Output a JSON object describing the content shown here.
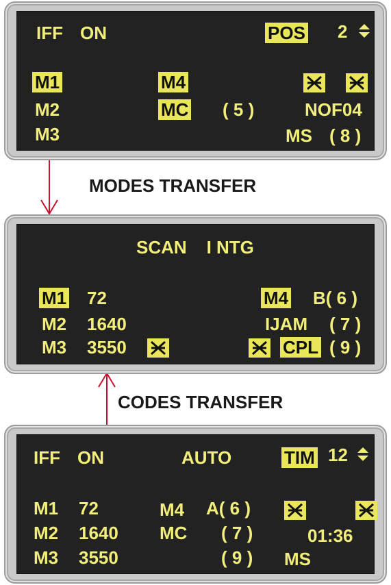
{
  "top": {
    "iff": "IFF",
    "on": "ON",
    "pos": "POS",
    "pos_num": "2",
    "m1": "M1",
    "m2": "M2",
    "m3": "M3",
    "m4": "M4",
    "mc": "MC",
    "mc_val": "( 5 )",
    "nof": "NOF04",
    "ms": "MS",
    "ms_val": "( 8 )"
  },
  "modes_transfer": "MODES TRANSFER",
  "middle": {
    "title": "SCAN    I NTG",
    "m1": "M1",
    "m1_val": "72",
    "m2": "M2",
    "m2_val": "1640",
    "m3": "M3",
    "m3_val": "3550",
    "m4": "M4",
    "m4_val": "B( 6 )",
    "ijam": "IJAM",
    "ijam_val": "( 7 )",
    "cpl": "CPL",
    "cpl_val": "( 9 )"
  },
  "codes_transfer": "CODES TRANSFER",
  "bottom": {
    "iff": "IFF",
    "on": "ON",
    "auto": "AUTO",
    "tim": "TIM",
    "tim_num": "12",
    "m1": "M1",
    "m1_val": "72",
    "m2": "M2",
    "m2_val": "1640",
    "m3": "M3",
    "m3_val": "3550",
    "m4": "M4",
    "m4_val": "A( 6 )",
    "mc": "MC",
    "mc_val": "( 7 )",
    "p9": "( 9 )",
    "time": "01:36",
    "ms": "MS"
  },
  "colors": {
    "screen_bg": "#222222",
    "text": "#f2ee7c",
    "highlight": "#e9e65a",
    "arrow": "#c8102e"
  },
  "icons": [
    "x-cross-icon",
    "updown-arrows-icon",
    "red-arrow-down",
    "red-arrow-up"
  ]
}
